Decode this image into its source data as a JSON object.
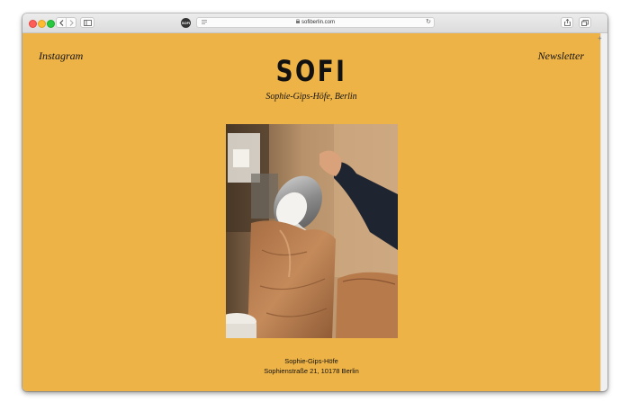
{
  "browser": {
    "url": "sofiberlin.com",
    "favicon_text": "SOFI"
  },
  "site": {
    "logo": "SOFI",
    "subtitle": "Sophie-Gips-Höfe, Berlin",
    "nav": {
      "instagram": "Instagram",
      "newsletter": "Newsletter"
    },
    "address": {
      "line1": "Sophie-Gips-Höfe",
      "line2": "Sophienstraße 21, 10178 Berlin"
    },
    "background_color": "#eeb347"
  }
}
